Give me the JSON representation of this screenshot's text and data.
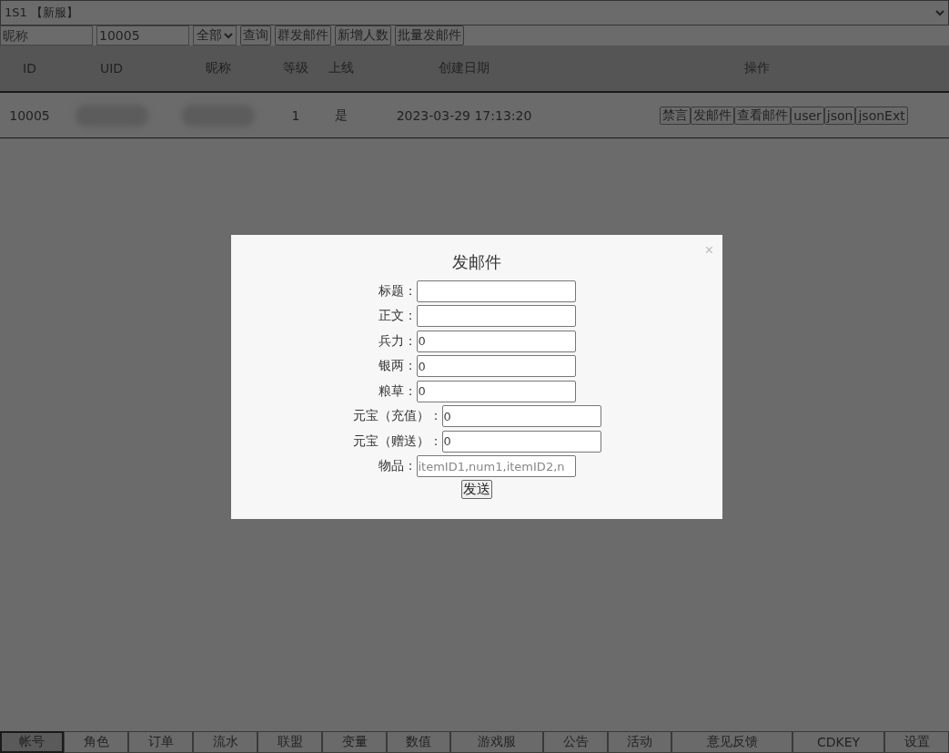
{
  "server_select": {
    "value": "1S1 【新服】"
  },
  "filters": {
    "nickname": {
      "placeholder": "昵称"
    },
    "uid": {
      "value": "10005"
    },
    "scope": {
      "value": "全部"
    },
    "buttons": [
      "查询",
      "群发邮件",
      "新增人数",
      "批量发邮件"
    ]
  },
  "table": {
    "columns": [
      "ID",
      "UID",
      "昵称",
      "等级",
      "上线",
      "创建日期",
      "操作"
    ],
    "rows": [
      {
        "id": "10005",
        "uid_redacted": true,
        "nickname_redacted": true,
        "level": "1",
        "online": "是",
        "created": "2023-03-29 17:13:20",
        "actions": [
          "禁言",
          "发邮件",
          "查看邮件",
          "user",
          "json",
          "jsonExt"
        ]
      }
    ]
  },
  "dialog": {
    "title": "发邮件",
    "close": "×",
    "fields": [
      {
        "label": "标题："
      },
      {
        "label": "正文："
      },
      {
        "label": "兵力：",
        "value": "0"
      },
      {
        "label": "银两：",
        "value": "0"
      },
      {
        "label": "粮草：",
        "value": "0"
      },
      {
        "label": "元宝（充值）：",
        "value": "0"
      },
      {
        "label": "元宝（赠送）：",
        "value": "0"
      },
      {
        "label": "物品：",
        "placeholder": "itemID1,num1,itemID2,n"
      }
    ],
    "submit": "发送"
  },
  "bottom_tabs": [
    {
      "label": "帐号",
      "selected": true
    },
    {
      "label": "角色",
      "selected": false
    },
    {
      "label": "订单",
      "selected": false
    },
    {
      "label": "流水",
      "selected": false
    },
    {
      "label": "联盟",
      "selected": false
    },
    {
      "label": "变量",
      "selected": false
    },
    {
      "label": "数值",
      "selected": false
    },
    {
      "label": "游戏服",
      "selected": false
    },
    {
      "label": "公告",
      "selected": false
    },
    {
      "label": "活动",
      "selected": false
    },
    {
      "label": "意见反馈",
      "selected": false
    },
    {
      "label": "CDKEY",
      "selected": false
    },
    {
      "label": "设置",
      "selected": false
    }
  ]
}
